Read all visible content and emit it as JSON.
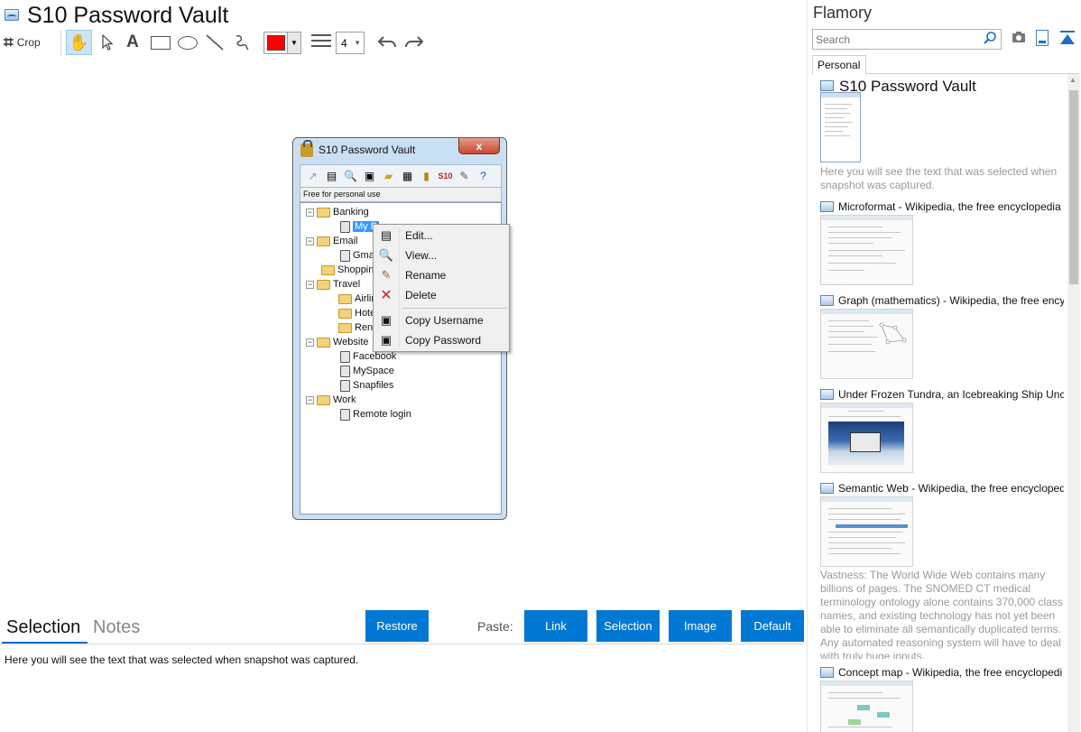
{
  "app": {
    "title": "S10 Password Vault"
  },
  "toolbar": {
    "crop_label": "Crop",
    "line_width_value": "4",
    "color_value": "#ff0000"
  },
  "vault_window": {
    "title": "S10 Password Vault",
    "close_label": "x",
    "status": "Free for personal use",
    "tree": [
      {
        "label": "Banking",
        "type": "folder"
      },
      {
        "label": "My Bank",
        "type": "item",
        "visible_label": "My B"
      },
      {
        "label": "Email",
        "type": "folder"
      },
      {
        "label": "Gma",
        "type": "item"
      },
      {
        "label": "Shoppin",
        "type": "folder"
      },
      {
        "label": "Travel",
        "type": "folder"
      },
      {
        "label": "Airlin",
        "type": "folder"
      },
      {
        "label": "Hote",
        "type": "folder"
      },
      {
        "label": "Ren",
        "type": "folder"
      },
      {
        "label": "Website",
        "type": "folder"
      },
      {
        "label": "Facebook",
        "type": "item"
      },
      {
        "label": "MySpace",
        "type": "item"
      },
      {
        "label": "Snapfiles",
        "type": "item"
      },
      {
        "label": "Work",
        "type": "folder"
      },
      {
        "label": "Remote login",
        "type": "item"
      }
    ]
  },
  "context_menu": {
    "items": [
      {
        "label": "Edit...",
        "icon": "edit-icon"
      },
      {
        "label": "View...",
        "icon": "magnifier-icon"
      },
      {
        "label": "Rename",
        "icon": "pencil-icon"
      },
      {
        "label": "Delete",
        "icon": "delete-x-icon"
      },
      {
        "label": "Copy Username",
        "icon": "copy-username-icon"
      },
      {
        "label": "Copy Password",
        "icon": "copy-password-icon"
      }
    ]
  },
  "bottom_panel": {
    "tabs": [
      "Selection",
      "Notes"
    ],
    "restore_label": "Restore",
    "paste_label": "Paste:",
    "paste_buttons": [
      "Link",
      "Selection",
      "Image",
      "Default"
    ],
    "selection_text": "Here you will see the text that was selected when snapshot was captured."
  },
  "sidebar": {
    "app_name": "Flamory",
    "search_placeholder": "Search",
    "tab": "Personal",
    "snapshots": [
      {
        "title": "S10 Password Vault",
        "description": "Here you will see the text that was selected when snapshot was captured."
      },
      {
        "title": "Microformat - Wikipedia, the free encyclopedia",
        "description": ""
      },
      {
        "title": "Graph (mathematics) - Wikipedia, the free ency",
        "description": ""
      },
      {
        "title": "Under Frozen Tundra, an Icebreaking Ship Unco",
        "description": ""
      },
      {
        "title": "Semantic Web - Wikipedia, the free encycloped",
        "description": "Vastness: The World Wide Web contains many billions of pages. The SNOMED CT medical terminology ontology alone contains 370,000 class names, and existing technology has not yet been able to eliminate all semantically duplicated terms. Any automated reasoning system will have to deal with truly huge inputs."
      },
      {
        "title": "Concept map - Wikipedia, the free encyclopedi",
        "description": ""
      }
    ]
  },
  "colors": {
    "accent": "#0078d4",
    "selected_tool_bg": "#cce4f7"
  }
}
